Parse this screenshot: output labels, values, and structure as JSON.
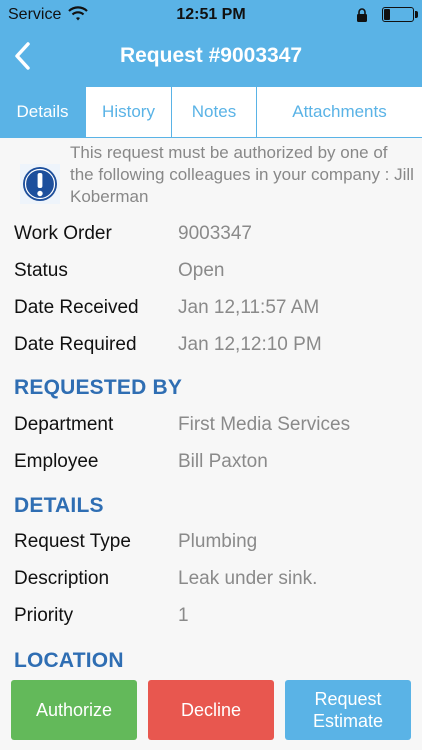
{
  "status_bar": {
    "carrier": "Service",
    "time": "12:51 PM"
  },
  "header": {
    "title": "Request #9003347"
  },
  "tabs": [
    {
      "label": "Details",
      "active": true
    },
    {
      "label": "History",
      "active": false
    },
    {
      "label": "Notes",
      "active": false
    },
    {
      "label": "Attachments",
      "active": false
    }
  ],
  "notice": {
    "text": "This request must be authorized by one of the following colleagues in your company : Jill Koberman"
  },
  "summary": [
    {
      "label": "Work Order",
      "value": "9003347"
    },
    {
      "label": "Status",
      "value": "Open"
    },
    {
      "label": "Date Received",
      "value": "Jan 12,11:57 AM"
    },
    {
      "label": "Date Required",
      "value": "Jan 12,12:10 PM"
    }
  ],
  "requested_by": {
    "heading": "REQUESTED BY",
    "rows": [
      {
        "label": "Department",
        "value": "First Media Services"
      },
      {
        "label": "Employee",
        "value": "Bill Paxton"
      }
    ]
  },
  "details": {
    "heading": "DETAILS",
    "rows": [
      {
        "label": "Request Type",
        "value": "Plumbing"
      },
      {
        "label": "Description",
        "value": "Leak under sink."
      },
      {
        "label": "Priority",
        "value": "1"
      }
    ]
  },
  "location": {
    "heading": "LOCATION"
  },
  "actions": {
    "authorize": "Authorize",
    "decline": "Decline",
    "estimate": "Request\nEstimate"
  },
  "colors": {
    "header": "#5ab3e6",
    "section_heading": "#2f6eb3",
    "authorize": "#63b95a",
    "decline": "#e8574f",
    "estimate": "#5ab3e6"
  }
}
